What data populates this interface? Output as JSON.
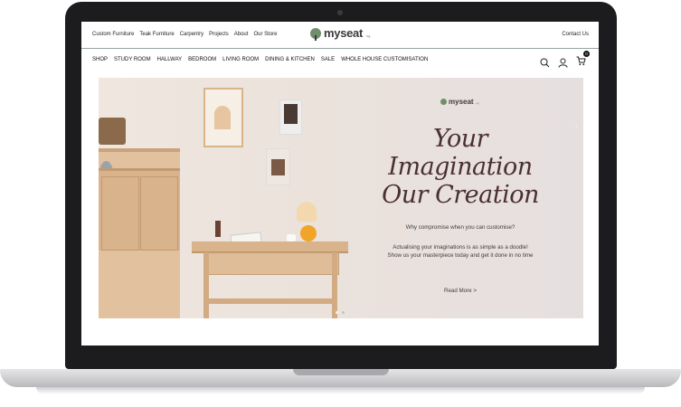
{
  "header": {
    "top_links": [
      "Custom Furniture",
      "Teak Furniture",
      "Carpentry",
      "Projects",
      "About",
      "Our Store"
    ],
    "logo_text": "myseat",
    "logo_sub": ".sg",
    "contact": "Contact Us"
  },
  "nav": {
    "items": [
      "SHOP",
      "STUDY ROOM",
      "HALLWAY",
      "BEDROOM",
      "LIVING ROOM",
      "DINING & KITCHEN",
      "SALE",
      "WHOLE HOUSE CUSTOMISATION"
    ],
    "cart_count": "0"
  },
  "hero": {
    "logo_text": "myseat",
    "logo_sub": ".sg",
    "headline_line1": "Your Imagination",
    "headline_line2": "Our Creation",
    "tagline": "Why compromise when you can customise?",
    "desc_line1": "Actualising your imaginations is as simple as a doodle!",
    "desc_line2": "Show us your masterpiece today and get it done in no time",
    "read_more": "Read More >",
    "next_arrow": "›",
    "slide_count": 2,
    "active_slide": 1
  },
  "colors": {
    "accent": "#4a3030",
    "bezel": "#1c1c1e",
    "hero_bg": "#ebe2dc"
  }
}
